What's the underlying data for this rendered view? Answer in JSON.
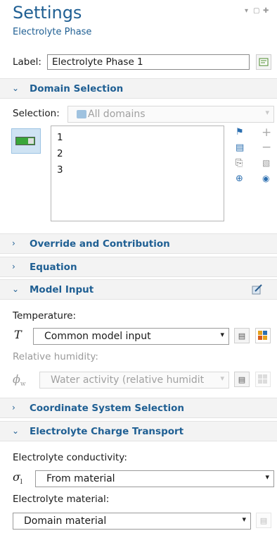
{
  "header": {
    "title": "Settings",
    "subtitle": "Electrolyte Phase"
  },
  "label_row": {
    "label": "Label:",
    "value": "Electrolyte Phase 1"
  },
  "domain_selection": {
    "title": "Domain Selection",
    "selection_label": "Selection:",
    "selection_value": "All domains",
    "items": [
      "1",
      "2",
      "3"
    ]
  },
  "sections": {
    "override": "Override and Contribution",
    "equation": "Equation",
    "model_input": "Model Input",
    "coord": "Coordinate System Selection",
    "charge_transport": "Electrolyte Charge Transport"
  },
  "model_input": {
    "temperature_label": "Temperature:",
    "temperature_symbol": "T",
    "temperature_value": "Common model input",
    "humidity_label": "Relative humidity:",
    "humidity_symbol": "ϕ",
    "humidity_sub": "w",
    "humidity_value": "Water activity (relative humidit"
  },
  "charge_transport": {
    "conductivity_label": "Electrolyte conductivity:",
    "conductivity_symbol": "σ",
    "conductivity_sub": "l",
    "conductivity_value": "From material",
    "material_label": "Electrolyte material:",
    "material_value": "Domain material"
  }
}
